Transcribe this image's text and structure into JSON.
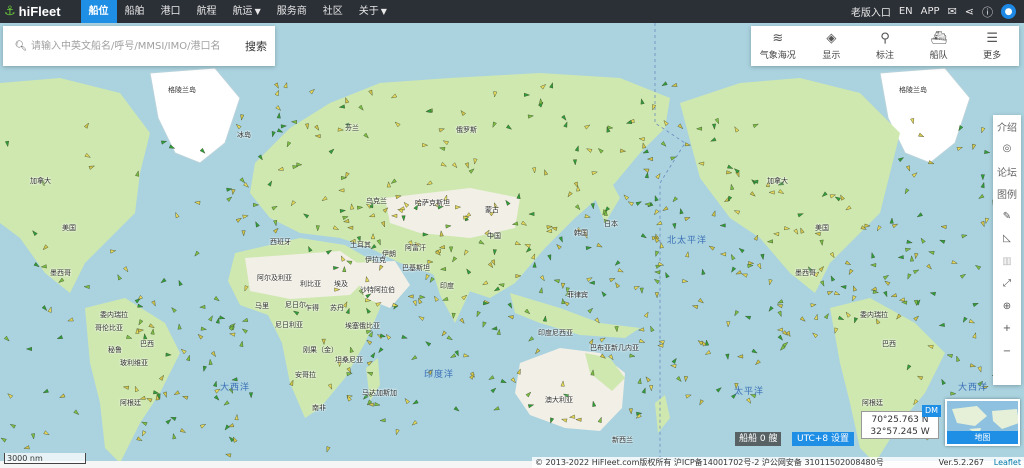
{
  "brand": {
    "name": "hiFleet"
  },
  "nav": {
    "items": [
      {
        "label": "船位",
        "active": true
      },
      {
        "label": "船舶"
      },
      {
        "label": "港口"
      },
      {
        "label": "航程"
      },
      {
        "label": "航运",
        "dropdown": true
      },
      {
        "label": "服务商"
      },
      {
        "label": "社区"
      },
      {
        "label": "关于",
        "dropdown": true
      }
    ]
  },
  "top_right": {
    "old_version": "老版入口",
    "language": "EN",
    "app": "APP"
  },
  "search": {
    "placeholder": "请输入中英文船名/呼号/MMSI/IMO/港口名",
    "button": "搜索"
  },
  "tools": [
    {
      "label": "气象海况",
      "icon": "wind-icon"
    },
    {
      "label": "显示",
      "icon": "layers-icon"
    },
    {
      "label": "标注",
      "icon": "pin-icon"
    },
    {
      "label": "船队",
      "icon": "fleet-icon"
    },
    {
      "label": "更多",
      "icon": "menu-icon"
    }
  ],
  "sidebar": {
    "intro": "介绍",
    "forum": "论坛",
    "legend": "图例"
  },
  "map_labels": {
    "greenland_w": "格陵兰岛",
    "greenland_e": "格陵兰岛",
    "iceland": "冰岛",
    "finland": "芬兰",
    "russia": "俄罗斯",
    "canada_w": "加拿大",
    "canada_e": "加拿大",
    "usa_w": "美国",
    "usa_e": "美国",
    "mexico_w": "墨西哥",
    "mexico_e": "墨西哥",
    "venezuela_w": "委内瑞拉",
    "venezuela_e": "委内瑞拉",
    "colombia": "哥伦比亚",
    "peru": "秘鲁",
    "brazil_w": "巴西",
    "brazil_e": "巴西",
    "bolivia": "玻利维亚",
    "argentina_w": "阿根廷",
    "argentina_e": "阿根廷",
    "kazakhstan": "哈萨克斯坦",
    "mongolia": "蒙古",
    "china": "中国",
    "turkey": "土耳其",
    "iran": "伊朗",
    "iraq": "伊拉克",
    "afghanistan": "阿富汗",
    "pakistan": "巴基斯坦",
    "india": "印度",
    "algeria": "阿尔及利亚",
    "libya": "利比亚",
    "egypt": "埃及",
    "saudi": "沙特阿拉伯",
    "mali": "马里",
    "niger": "尼日尔",
    "chad": "乍得",
    "sudan": "苏丹",
    "nigeria": "尼日利亚",
    "ethiopia": "埃塞俄比亚",
    "drc": "刚果（金）",
    "tanzania": "坦桑尼亚",
    "angola": "安哥拉",
    "south_africa": "南非",
    "madagascar": "马达加斯加",
    "indonesia": "印度尼西亚",
    "australia": "澳大利亚",
    "new_zealand": "新西兰",
    "japan": "日本",
    "korea": "韩国",
    "philippines": "菲律宾",
    "papua": "巴布亚新几内亚",
    "ukraine": "乌克兰",
    "spain": "西班牙"
  },
  "ocean_labels": {
    "atlantic_w": "大西洋",
    "atlantic_e": "大西洋",
    "indian": "印度洋",
    "north_pacific": "北太平洋",
    "pacific": "太平洋"
  },
  "scale": "3000 nm",
  "ship_count": "船船 0 艘",
  "utc_button": "UTC+8 设置",
  "coordinates": {
    "lat": "70°25.763 N",
    "lon": "32°57.245 W"
  },
  "dm_button": "DM",
  "minimap_label": "地图",
  "footer": {
    "copyright": "© 2013-2022 HiFleet.com版权所有 沪ICP备14001702号-2 沪公网安备 31011502008480号",
    "version": "Ver.5.2.267",
    "leaflet": "Leaflet"
  },
  "colors": {
    "ocean": "#aad3df",
    "land": "#cfe8b0",
    "desert": "#f2efe6",
    "ice": "#ffffff",
    "accent": "#1f8fe6",
    "topbar": "#2b2f36"
  }
}
